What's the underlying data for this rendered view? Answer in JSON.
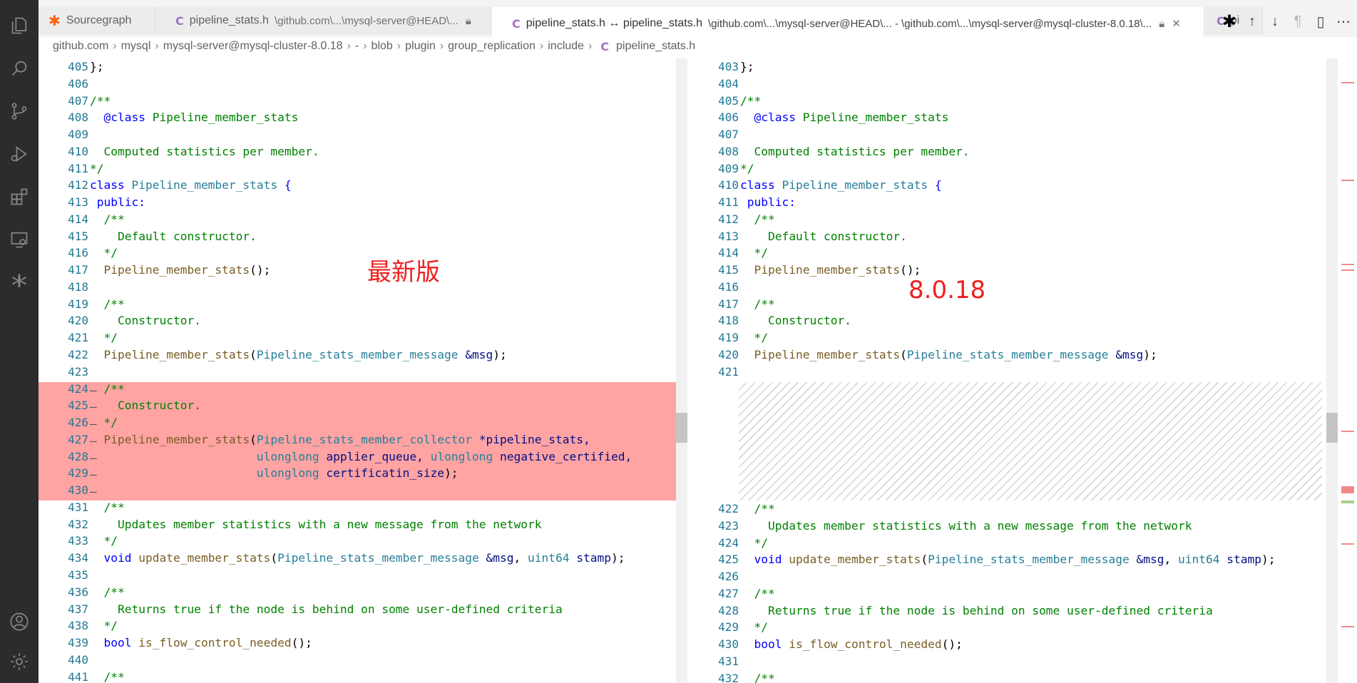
{
  "tabs": [
    {
      "title": "Sourcegraph",
      "description": ""
    },
    {
      "title": "pipeline_stats.h",
      "description": "\\github.com\\...\\mysql-server@HEAD\\..."
    },
    {
      "title": "pipeline_stats.h ↔ pipeline_stats.h",
      "description": "\\github.com\\...\\mysql-server@HEAD\\... - \\github.com\\...\\mysql-server@mysql-cluster-8.0.18\\..."
    },
    {
      "title": "pi",
      "description": ""
    }
  ],
  "breadcrumb": [
    "github.com",
    "mysql",
    "mysql-server@mysql-cluster-8.0.18",
    "-",
    "blob",
    "plugin",
    "group_replication",
    "include",
    "pipeline_stats.h"
  ],
  "annotations": {
    "left": "最新版",
    "right": "8.0.18"
  },
  "left_pane": {
    "line_numbers": [
      "405",
      "406",
      "407",
      "408",
      "409",
      "410",
      "411",
      "412",
      "413",
      "414",
      "415",
      "416",
      "417",
      "418",
      "419",
      "420",
      "421",
      "422",
      "423",
      "424",
      "425",
      "426",
      "427",
      "428",
      "429",
      "430",
      "431",
      "432",
      "433",
      "434",
      "435",
      "436",
      "437",
      "438",
      "439",
      "440",
      "441"
    ],
    "removed_marker": "—"
  },
  "right_pane": {
    "line_numbers_top": [
      "403",
      "404",
      "405",
      "406",
      "407",
      "408",
      "409",
      "410",
      "411",
      "412",
      "413",
      "414",
      "415",
      "416",
      "417",
      "418",
      "419",
      "420",
      "421"
    ],
    "line_numbers_bottom": [
      "422",
      "423",
      "424",
      "425",
      "426",
      "427",
      "428",
      "429",
      "430",
      "431",
      "432"
    ]
  },
  "code": {
    "l_close": "};",
    "l_doc_open": "/**",
    "l_class_tag": "@class",
    "l_class_name": "Pipeline_member_stats",
    "l_computed": "Computed statistics per member.",
    "l_doc_close": "*/",
    "l_class_kw": "class",
    "l_brace": "{",
    "l_public": "public:",
    "l_default_ctor": "Default constructor.",
    "l_ctor_fn": "Pipeline_member_stats",
    "l_paren_semicolon": "();",
    "l_constructor": "Constructor.",
    "l_msg_type": "Pipeline_stats_member_message",
    "l_msg_ref": "&msg",
    "l_close_paren": ");",
    "l_open_paren": "(",
    "l_collector_type": "Pipeline_stats_member_collector",
    "l_collector_arg": "*pipeline_stats,",
    "l_ulonglong": "ulonglong",
    "l_applier": "applier_queue,",
    "l_neg": "negative_certified,",
    "l_cert": "certificatin_size",
    "l_updates": "Updates member statistics with a new message from the network",
    "l_void": "void",
    "l_update_fn": "update_member_stats",
    "l_comma": ",",
    "l_uint64": "uint64",
    "l_stamp": "stamp",
    "l_returns": "Returns true if the node is behind on some user-defined criteria",
    "l_bool": "bool",
    "l_flow_fn": "is_flow_control_needed",
    "l_flow_end": "();"
  },
  "colors": {
    "removed": "#ffa3a3",
    "keyword": "#0000ff",
    "comment": "#008000",
    "type": "#267f99",
    "function": "#795e26",
    "annotation": "#ee2020"
  }
}
